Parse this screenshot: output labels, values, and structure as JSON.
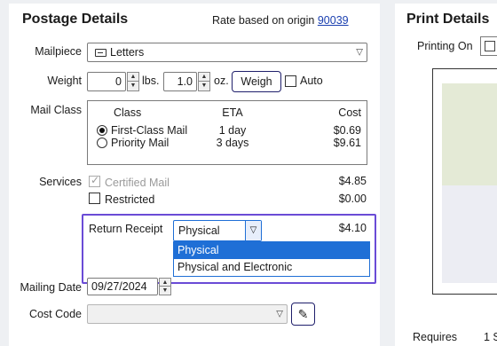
{
  "postage": {
    "title": "Postage Details",
    "rate_text": "Rate based on origin",
    "rate_zip": "90039",
    "mailpiece": {
      "label": "Mailpiece",
      "value": "Letters"
    },
    "weight": {
      "label": "Weight",
      "lbs": "0",
      "lbs_unit": "lbs.",
      "oz": "1.0",
      "oz_unit": "oz.",
      "weigh_button": "Weigh",
      "auto_label": "Auto"
    },
    "mail_class": {
      "label": "Mail Class",
      "headers": {
        "class": "Class",
        "eta": "ETA",
        "cost": "Cost"
      },
      "rows": [
        {
          "name": "First-Class Mail",
          "eta": "1 day",
          "cost": "$0.69",
          "selected": true
        },
        {
          "name": "Priority Mail",
          "eta": "3 days",
          "cost": "$9.61",
          "selected": false
        }
      ]
    },
    "services": {
      "label": "Services",
      "certified": {
        "label": "Certified Mail",
        "cost": "$4.85"
      },
      "restricted": {
        "label": "Restricted",
        "cost": "$0.00"
      }
    },
    "return_receipt": {
      "label": "Return Receipt",
      "value": "Physical",
      "cost": "$4.10",
      "options": [
        "Physical",
        "Physical and Electronic"
      ]
    },
    "mailing_date": {
      "label": "Mailing Date",
      "value": "09/27/2024"
    },
    "cost_code": {
      "label": "Cost Code",
      "value": ""
    }
  },
  "print": {
    "title": "Print Details",
    "printing_on_label": "Printing On",
    "requires_label": "Requires",
    "requires_value": "1 S"
  },
  "colors": {
    "focus": "#6a4bd6",
    "selection": "#1f6fd6",
    "link": "#1a3fb0"
  }
}
